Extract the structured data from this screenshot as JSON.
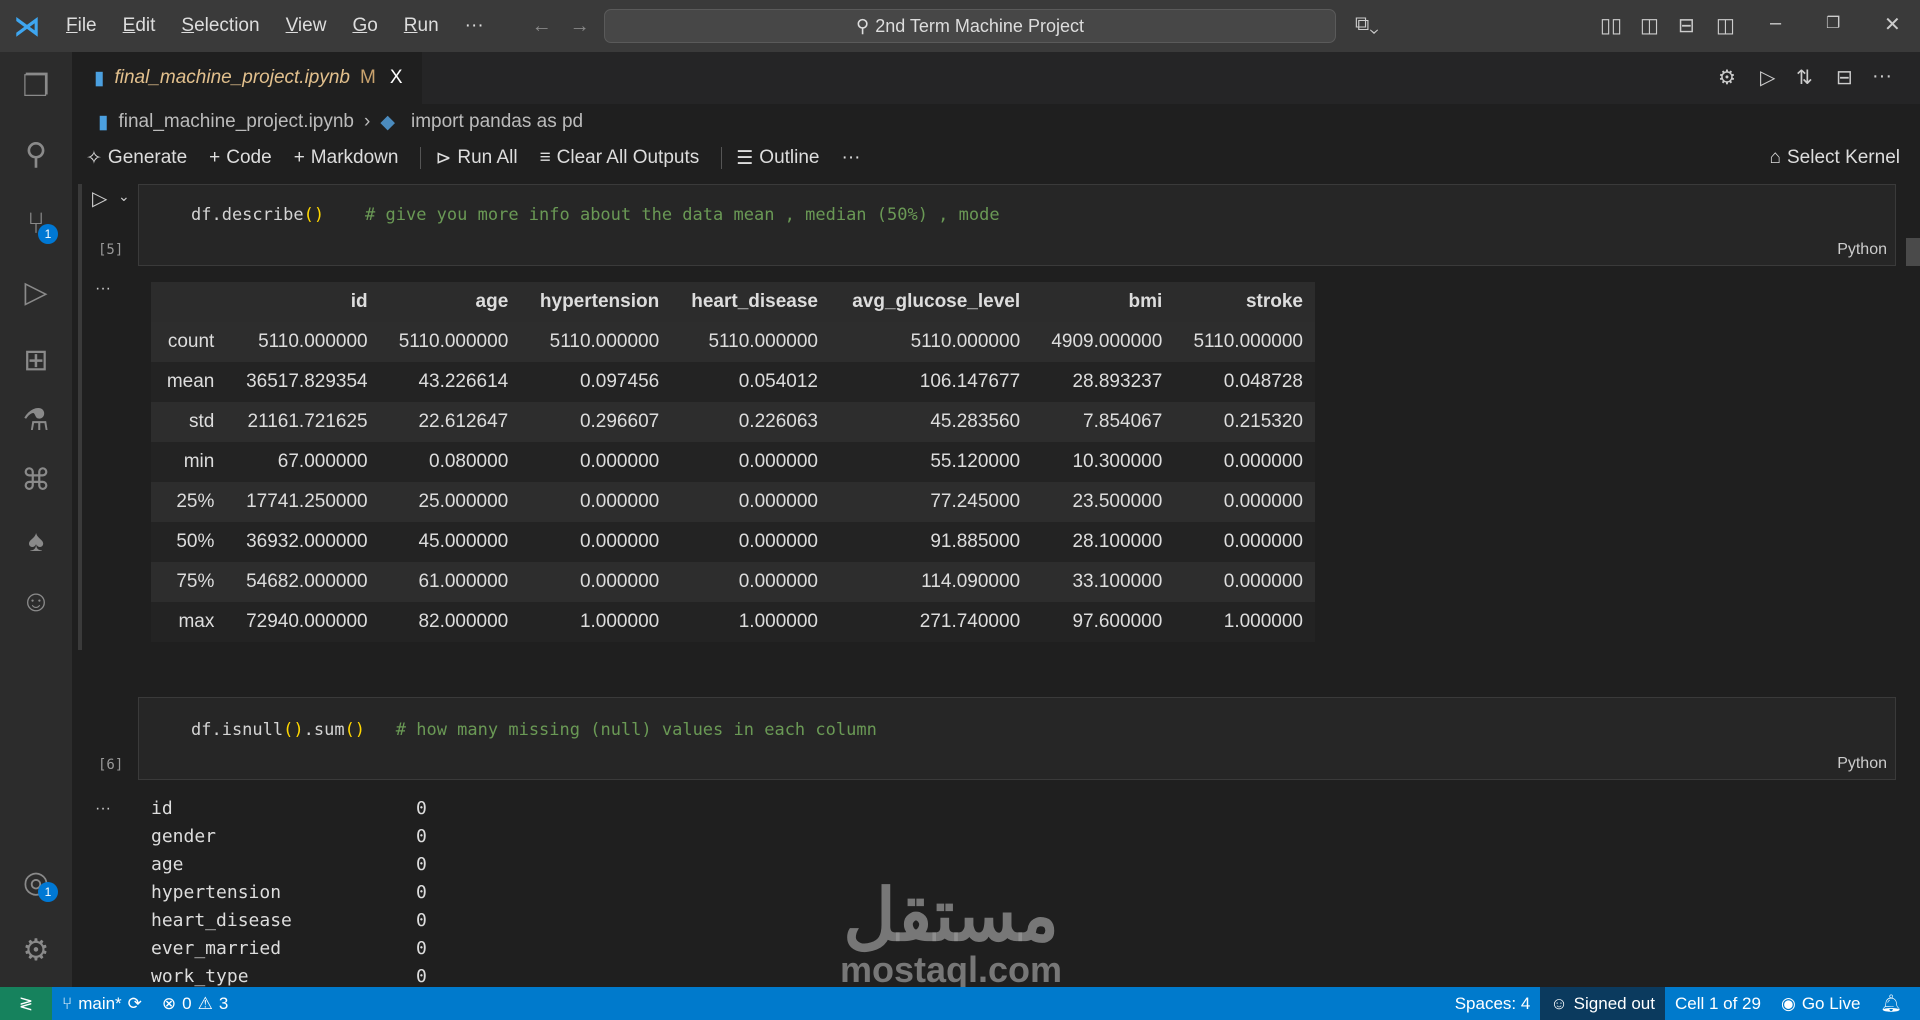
{
  "titlebar": {
    "menus": [
      "File",
      "Edit",
      "Selection",
      "View",
      "Go",
      "Run"
    ],
    "more": "···",
    "search": "2nd Term Machine Project"
  },
  "tab": {
    "name": "final_machine_project.ipynb",
    "modified": "M",
    "close": "X"
  },
  "breadcrumb": {
    "file": "final_machine_project.ipynb",
    "symbol": "import pandas as pd"
  },
  "toolbar": {
    "generate": "Generate",
    "code": "Code",
    "markdown": "Markdown",
    "run_all": "Run All",
    "clear": "Clear All Outputs",
    "outline": "Outline",
    "more": "···",
    "kernel": "Select Kernel"
  },
  "activity": {
    "scm_badge": "1",
    "account_badge": "1"
  },
  "cell1": {
    "code": "df.describe",
    "paren": "()",
    "comment": "# give you more info about the data mean , median (50%) , mode",
    "exec": "[5]",
    "lang": "Python"
  },
  "describe": {
    "columns": [
      "",
      "id",
      "age",
      "hypertension",
      "heart_disease",
      "avg_glucose_level",
      "bmi",
      "stroke"
    ],
    "rows": [
      [
        "count",
        "5110.000000",
        "5110.000000",
        "5110.000000",
        "5110.000000",
        "5110.000000",
        "4909.000000",
        "5110.000000"
      ],
      [
        "mean",
        "36517.829354",
        "43.226614",
        "0.097456",
        "0.054012",
        "106.147677",
        "28.893237",
        "0.048728"
      ],
      [
        "std",
        "21161.721625",
        "22.612647",
        "0.296607",
        "0.226063",
        "45.283560",
        "7.854067",
        "0.215320"
      ],
      [
        "min",
        "67.000000",
        "0.080000",
        "0.000000",
        "0.000000",
        "55.120000",
        "10.300000",
        "0.000000"
      ],
      [
        "25%",
        "17741.250000",
        "25.000000",
        "0.000000",
        "0.000000",
        "77.245000",
        "23.500000",
        "0.000000"
      ],
      [
        "50%",
        "36932.000000",
        "45.000000",
        "0.000000",
        "0.000000",
        "91.885000",
        "28.100000",
        "0.000000"
      ],
      [
        "75%",
        "54682.000000",
        "61.000000",
        "0.000000",
        "0.000000",
        "114.090000",
        "33.100000",
        "0.000000"
      ],
      [
        "max",
        "72940.000000",
        "82.000000",
        "1.000000",
        "1.000000",
        "271.740000",
        "97.600000",
        "1.000000"
      ]
    ]
  },
  "cell2": {
    "code1": "df.isnull",
    "p1": "()",
    "code2": ".sum",
    "p2": "()",
    "comment": "# how many missing (null) values in each column",
    "exec": "[6]",
    "lang": "Python"
  },
  "nulls": [
    [
      "id",
      "0"
    ],
    [
      "gender",
      "0"
    ],
    [
      "age",
      "0"
    ],
    [
      "hypertension",
      "0"
    ],
    [
      "heart_disease",
      "0"
    ],
    [
      "ever_married",
      "0"
    ],
    [
      "work_type",
      "0"
    ]
  ],
  "output_more": "···",
  "status": {
    "branch": "main*",
    "errors": "0",
    "warnings": "3",
    "spaces": "Spaces: 4",
    "signed": "Signed out",
    "cell": "Cell 1 of 29",
    "golive": "Go Live"
  },
  "watermark": {
    "arabic": "مستقل",
    "latin": "mostaql.com"
  }
}
